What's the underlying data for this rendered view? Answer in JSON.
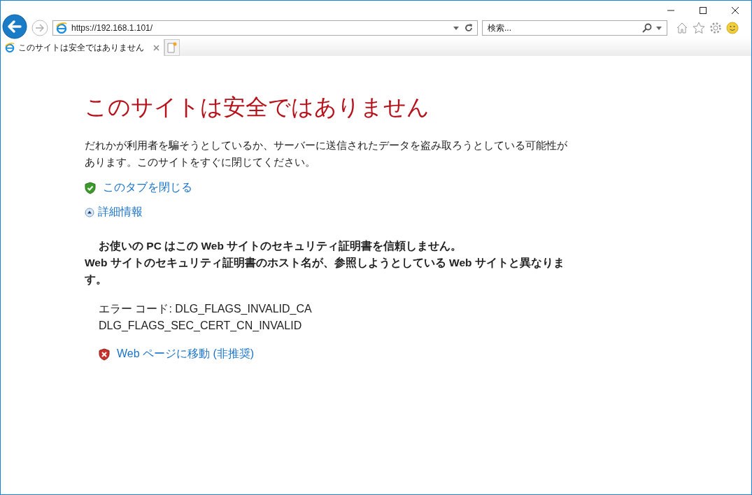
{
  "address_bar": {
    "url": "https://192.168.1.101/"
  },
  "search": {
    "placeholder": "検索..."
  },
  "tabs": [
    {
      "label": "このサイトは安全ではありません",
      "selected": true
    }
  ],
  "page": {
    "title": "このサイトは安全ではありません",
    "description": "だれかが利用者を騙そうとしているか、サーバーに送信されたデータを盗み取ろうとしている可能性があります。このサイトをすぐに閉じてください。",
    "close_tab_link": "このタブを閉じる",
    "more_info": {
      "label": "詳細情報",
      "expanded": true
    },
    "details": [
      "お使いの PC はこの Web サイトのセキュリティ証明書を信頼しません。",
      "Web サイトのセキュリティ証明書のホスト名が、参照しようとしている Web サイトと異なります。"
    ],
    "error_codes": [
      "エラー コード: DLG_FLAGS_INVALID_CA",
      "DLG_FLAGS_SEC_CERT_CN_INVALID"
    ],
    "proceed_link": "Web ページに移動 (非推奨)"
  }
}
